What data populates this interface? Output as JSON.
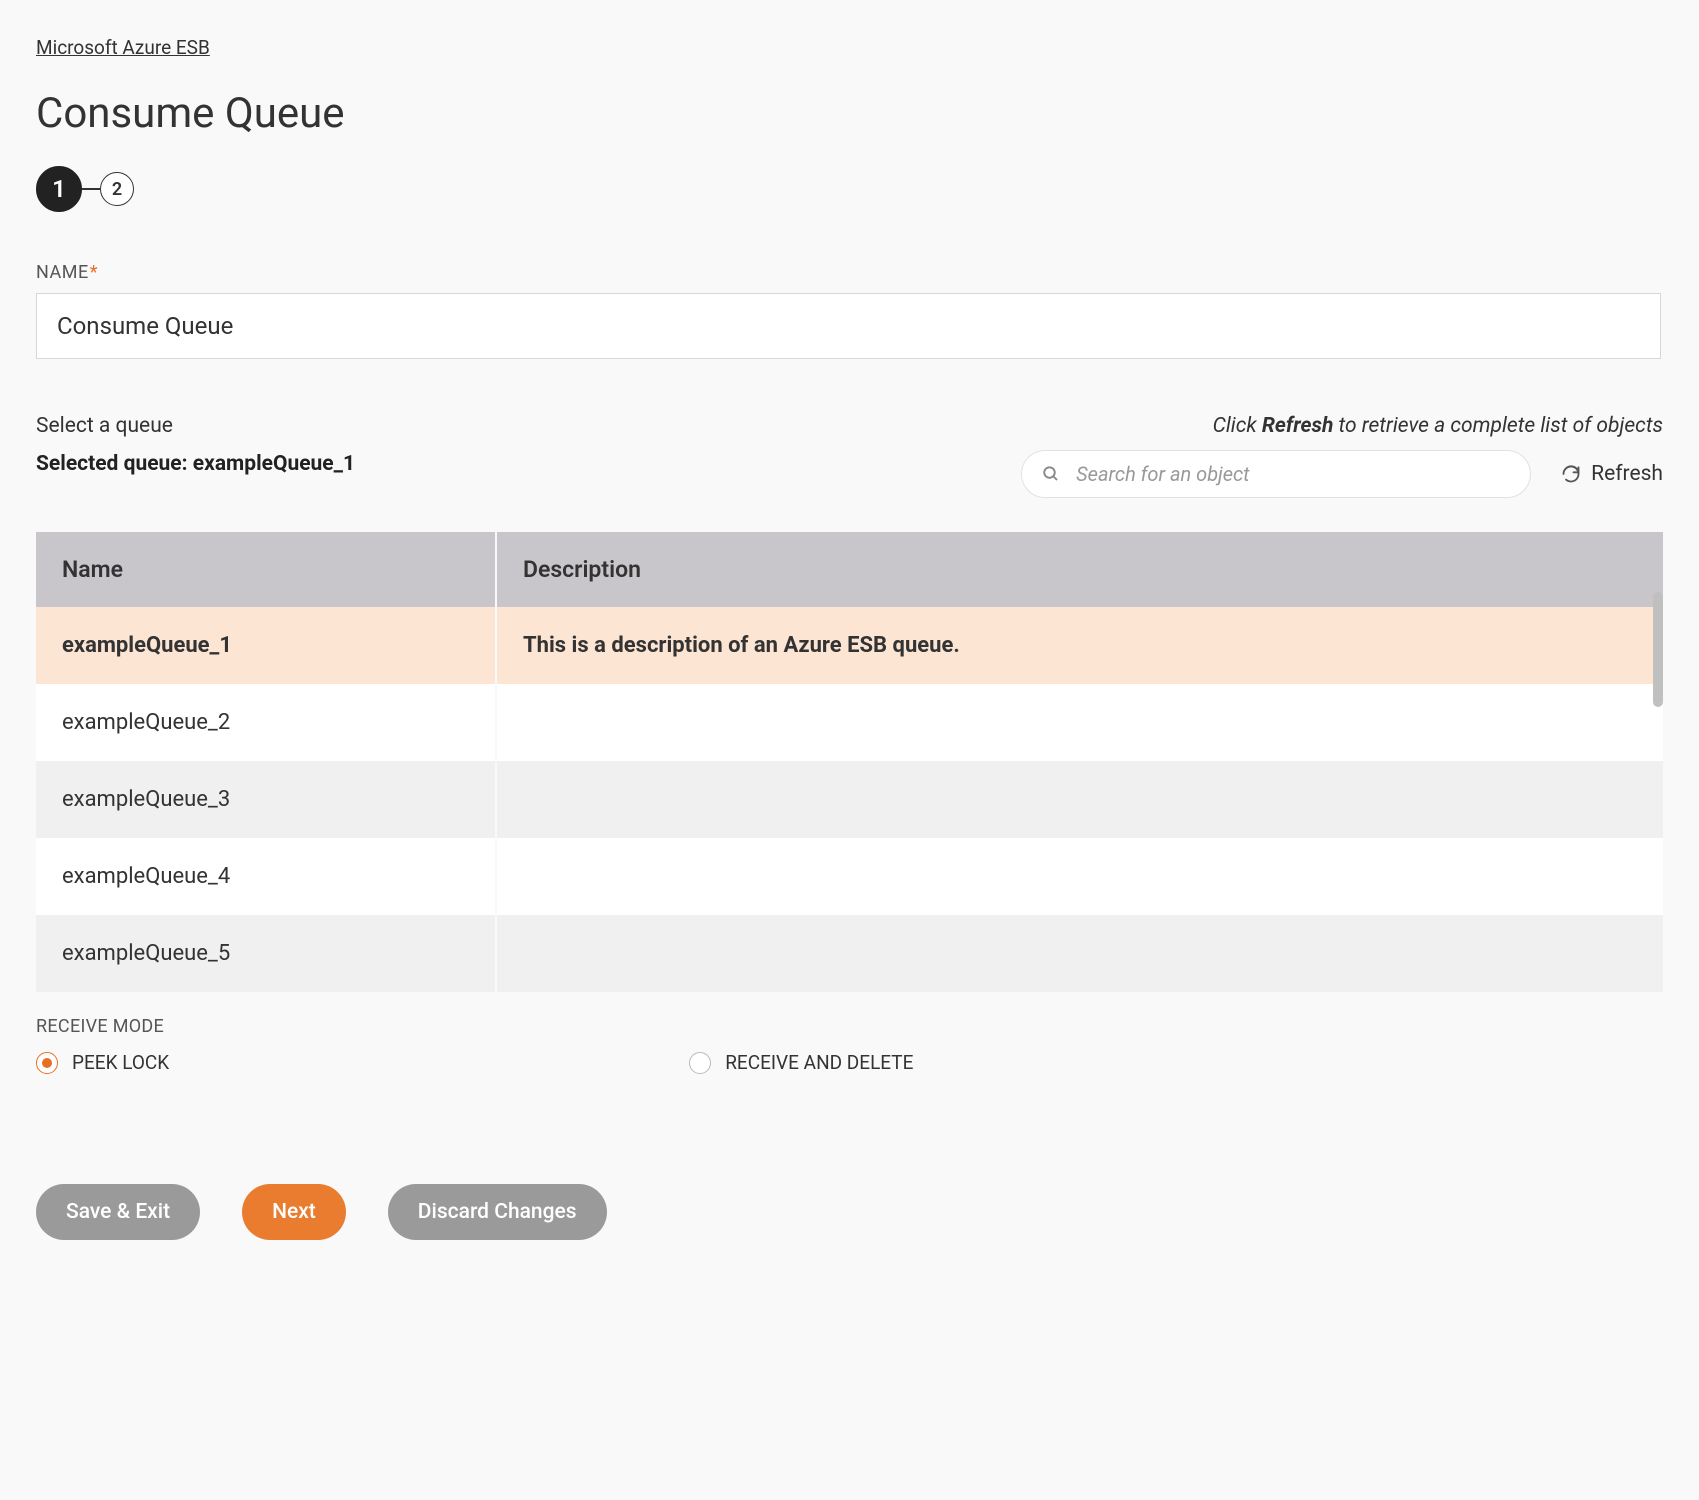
{
  "breadcrumb": "Microsoft Azure ESB",
  "page_title": "Consume Queue",
  "stepper": {
    "steps": [
      "1",
      "2"
    ],
    "active_index": 0
  },
  "name_field": {
    "label": "NAME",
    "required": true,
    "value": "Consume Queue"
  },
  "queue_picker": {
    "select_label": "Select a queue",
    "selected_prefix": "Selected queue: ",
    "selected_value": "exampleQueue_1",
    "hint_prefix": "Click ",
    "hint_bold": "Refresh",
    "hint_suffix": " to retrieve a complete list of objects",
    "search_placeholder": "Search for an object",
    "refresh_label": "Refresh",
    "columns": {
      "name": "Name",
      "description": "Description"
    },
    "rows": [
      {
        "name": "exampleQueue_1",
        "description": "This is a description of an Azure ESB queue.",
        "selected": true
      },
      {
        "name": "exampleQueue_2",
        "description": "",
        "selected": false
      },
      {
        "name": "exampleQueue_3",
        "description": "",
        "selected": false
      },
      {
        "name": "exampleQueue_4",
        "description": "",
        "selected": false
      },
      {
        "name": "exampleQueue_5",
        "description": "",
        "selected": false
      }
    ]
  },
  "receive_mode": {
    "label": "RECEIVE MODE",
    "options": [
      {
        "label": "PEEK LOCK",
        "checked": true
      },
      {
        "label": "RECEIVE AND DELETE",
        "checked": false
      }
    ]
  },
  "buttons": {
    "save_exit": "Save & Exit",
    "next": "Next",
    "discard": "Discard Changes"
  }
}
